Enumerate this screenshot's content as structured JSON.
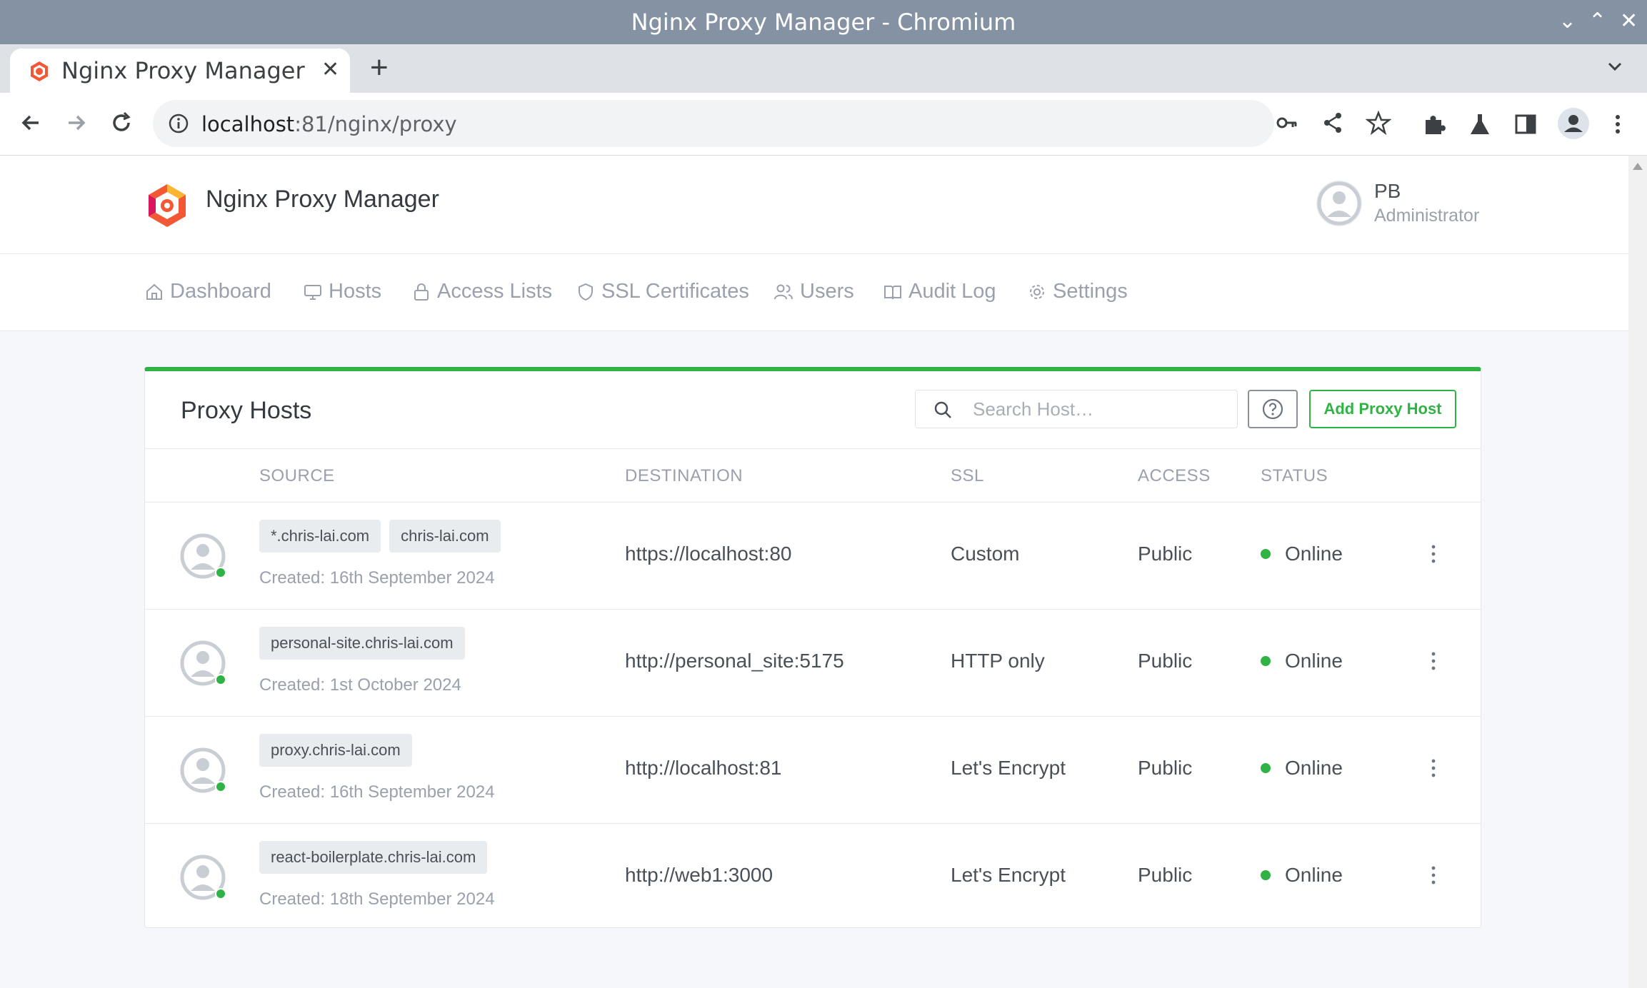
{
  "window": {
    "title": "Nginx Proxy Manager - Chromium"
  },
  "browser": {
    "tab_title": "Nginx Proxy Manager",
    "url_host": "localhost",
    "url_rest": ":81/nginx/proxy"
  },
  "app": {
    "brand": "Nginx Proxy Manager",
    "user": {
      "initials": "PB",
      "role": "Administrator"
    },
    "nav": [
      {
        "label": "Dashboard",
        "icon": "home-icon"
      },
      {
        "label": "Hosts",
        "icon": "monitor-icon"
      },
      {
        "label": "Access Lists",
        "icon": "lock-icon"
      },
      {
        "label": "SSL Certificates",
        "icon": "shield-icon"
      },
      {
        "label": "Users",
        "icon": "users-icon"
      },
      {
        "label": "Audit Log",
        "icon": "book-icon"
      },
      {
        "label": "Settings",
        "icon": "gear-icon"
      }
    ]
  },
  "card": {
    "title": "Proxy Hosts",
    "search_placeholder": "Search Host…",
    "add_button": "Add Proxy Host",
    "columns": [
      "SOURCE",
      "DESTINATION",
      "SSL",
      "ACCESS",
      "STATUS"
    ],
    "rows": [
      {
        "domains": [
          "*.chris-lai.com",
          "chris-lai.com"
        ],
        "created": "Created: 16th September 2024",
        "destination": "https://localhost:80",
        "ssl": "Custom",
        "access": "Public",
        "status": "Online"
      },
      {
        "domains": [
          "personal-site.chris-lai.com"
        ],
        "created": "Created: 1st October 2024",
        "destination": "http://personal_site:5175",
        "ssl": "HTTP only",
        "access": "Public",
        "status": "Online"
      },
      {
        "domains": [
          "proxy.chris-lai.com"
        ],
        "created": "Created: 16th September 2024",
        "destination": "http://localhost:81",
        "ssl": "Let's Encrypt",
        "access": "Public",
        "status": "Online"
      },
      {
        "domains": [
          "react-boilerplate.chris-lai.com"
        ],
        "created": "Created: 18th September 2024",
        "destination": "http://web1:3000",
        "ssl": "Let's Encrypt",
        "access": "Public",
        "status": "Online"
      }
    ]
  },
  "colors": {
    "accent": "#2fb344",
    "titlebar": "#8492a3",
    "online": "#2fb344"
  }
}
